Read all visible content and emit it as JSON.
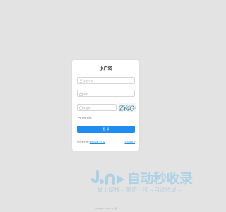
{
  "login": {
    "title": "小广袋",
    "username_placeholder": "手机号码",
    "password_placeholder": "密码",
    "captcha_placeholder": "验证码",
    "captcha_text": "ZY4G",
    "remember_label": "记住密码",
    "login_button": "登 录",
    "no_account_text": "还没有账号?",
    "register_link": "免费注册小广袋",
    "forgot_link": "忘记密码?"
  },
  "watermark": {
    "title": "自动秒收录",
    "slogan": "做上链接→来访一次→自动收录→"
  },
  "footer": {
    "copyright": "Copyright © 2024 小广袋"
  },
  "colors": {
    "page_background": "#e3e3e3",
    "accent": "#1e8cf0",
    "watermark_blue": "#66bde9"
  }
}
